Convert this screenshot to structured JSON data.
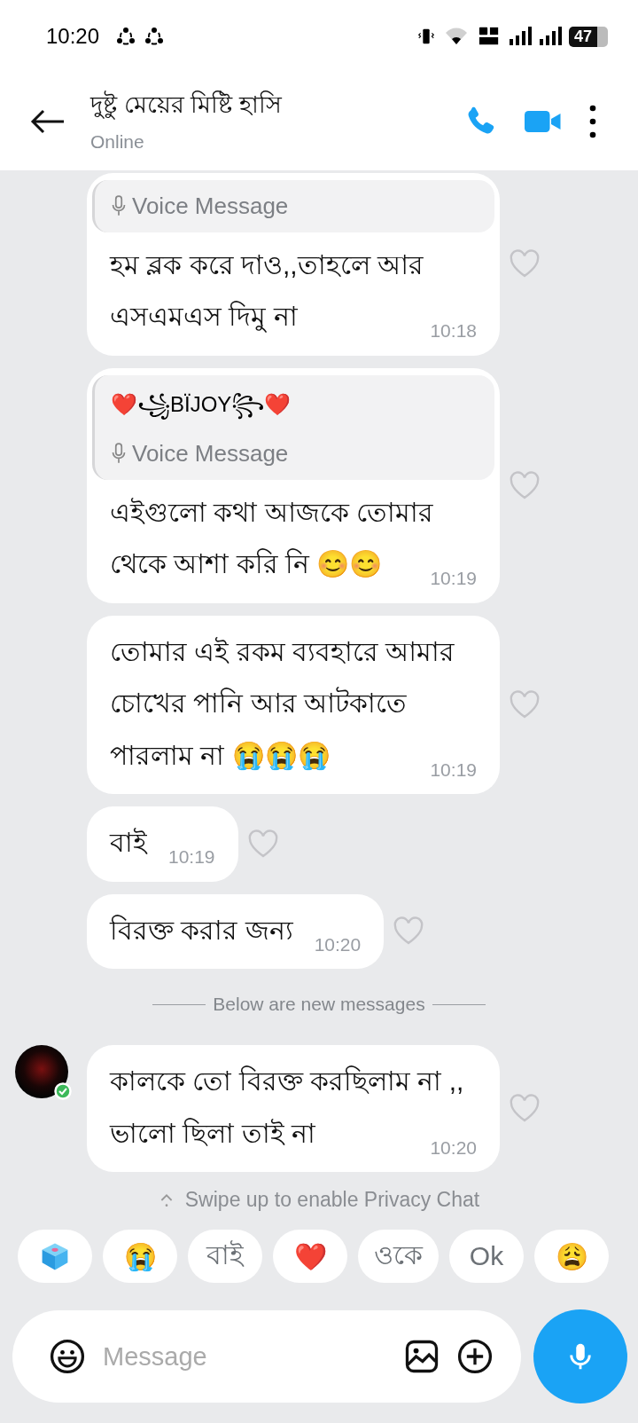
{
  "status_bar": {
    "time": "10:20",
    "battery": "47"
  },
  "header": {
    "title": "দুষ্টু মেয়ের মিষ্টি হাসি",
    "status": "Online"
  },
  "messages": [
    {
      "quote": {
        "kind": "voice",
        "label": "Voice Message"
      },
      "text": "হম ব্লক করে দাও,,তাহলে আর এসএমএস দিমু না",
      "time": "10:18",
      "liked": false
    },
    {
      "quote": {
        "kind": "voice",
        "sender": "❤️꧁BÏJOY꧂❤️",
        "label": "Voice Message"
      },
      "text": "এইগুলো কথা আজকে তোমার থেকে আশা করি নি 😊😊",
      "time": "10:19",
      "liked": false
    },
    {
      "text": "তোমার এই রকম ব্যবহারে আমার চোখের পানি আর আটকাতে পারলাম না 😭😭😭",
      "time": "10:19",
      "liked": false
    },
    {
      "text": "বাই",
      "time": "10:19",
      "liked": false
    },
    {
      "text": "বিরক্ত করার জন্য",
      "time": "10:20",
      "liked": false
    },
    {
      "kind": "divider",
      "text": "Below are new messages"
    },
    {
      "text": "কালকে তো বিরক্ত করছিলাম না ,, ভালো ছিলা তাই না",
      "time": "10:20",
      "sender_avatar": {
        "online": true
      },
      "liked": false
    }
  ],
  "privacy_hint": "Swipe up to enable Privacy Chat",
  "quick_replies": [
    {
      "kind": "dice"
    },
    {
      "kind": "text",
      "text": "😭"
    },
    {
      "kind": "text",
      "text": "বাই"
    },
    {
      "kind": "text",
      "text": "❤️"
    },
    {
      "kind": "text",
      "text": "ওকে"
    },
    {
      "kind": "text",
      "text": "Ok"
    },
    {
      "kind": "text",
      "text": "😩"
    }
  ],
  "composer": {
    "placeholder": "Message"
  }
}
